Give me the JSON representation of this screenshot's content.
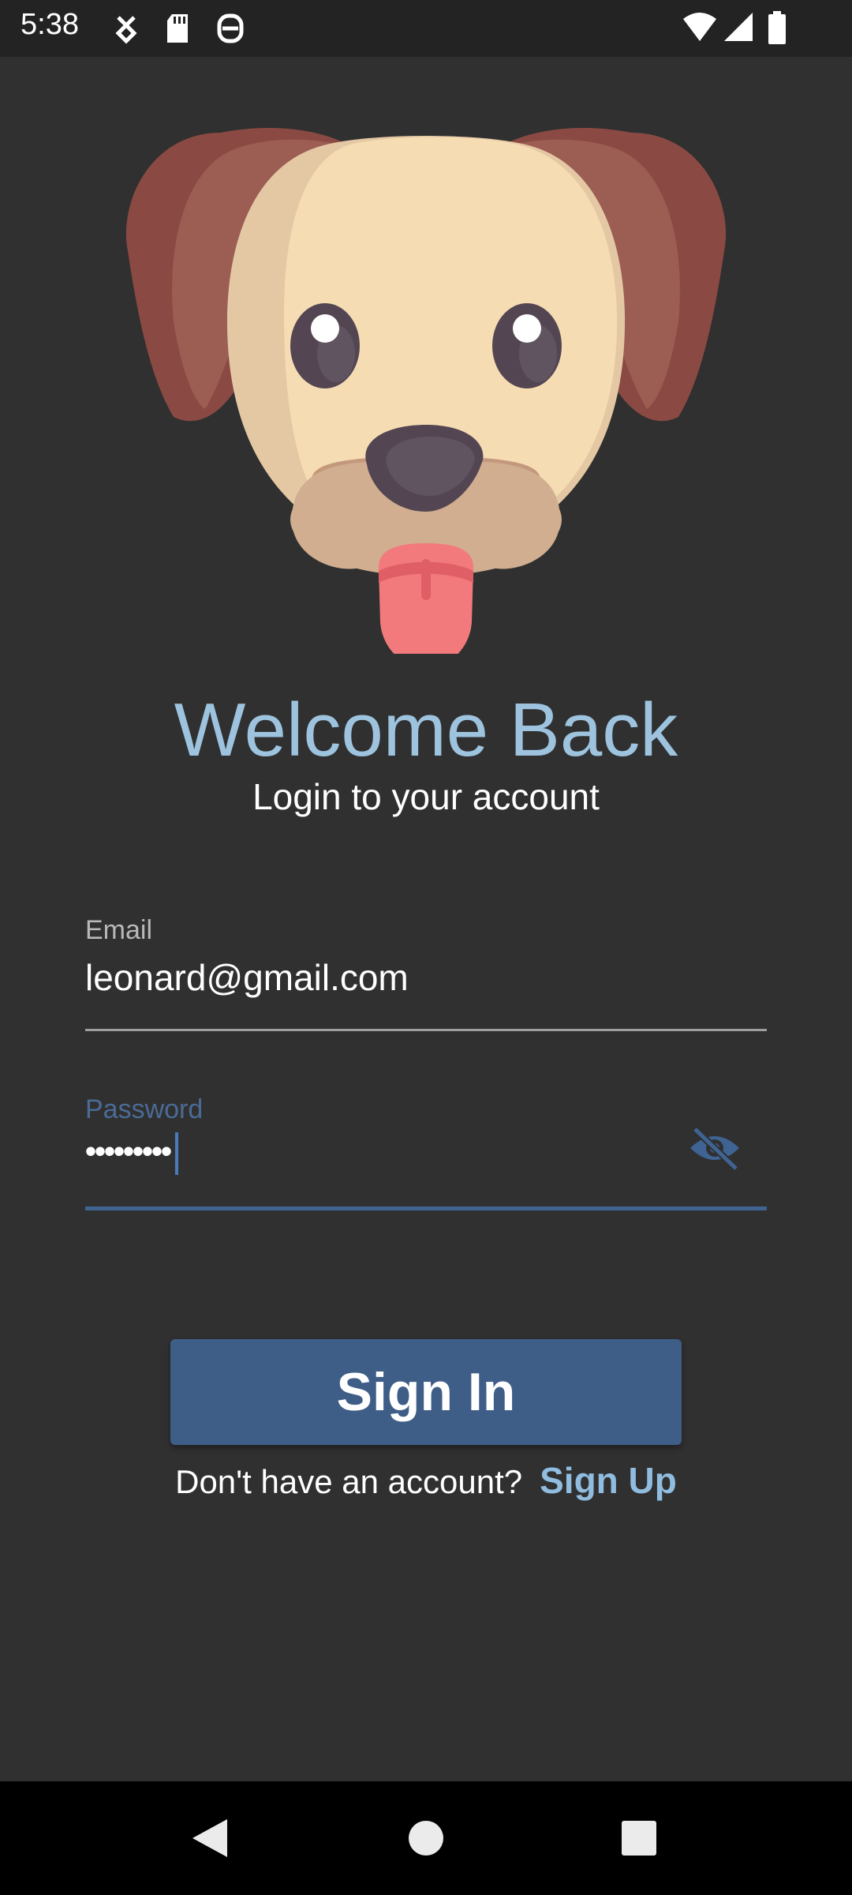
{
  "status_bar": {
    "time": "5:38",
    "left_icons": [
      "usb-debug-icon",
      "sd-card-icon",
      "data-saver-icon"
    ],
    "right_icons": [
      "wifi-icon",
      "cell-signal-icon",
      "battery-icon"
    ]
  },
  "logo": {
    "icon": "dog-face-icon"
  },
  "header": {
    "title": "Welcome Back",
    "subtitle": "Login to your account"
  },
  "form": {
    "email": {
      "label": "Email",
      "value": "leonard@gmail.com"
    },
    "password": {
      "label": "Password",
      "value": "•••••••••",
      "toggle_icon": "visibility-off-icon"
    }
  },
  "actions": {
    "sign_in_label": "Sign In",
    "signup_prompt": "Don't have an account?",
    "signup_link": "Sign Up"
  },
  "nav_bar": {
    "buttons": [
      "back-icon",
      "home-icon",
      "recents-icon"
    ]
  },
  "colors": {
    "background": "#303030",
    "accent": "#9dc3de",
    "button": "#3e5e87",
    "focused_field": "#3f6494"
  }
}
